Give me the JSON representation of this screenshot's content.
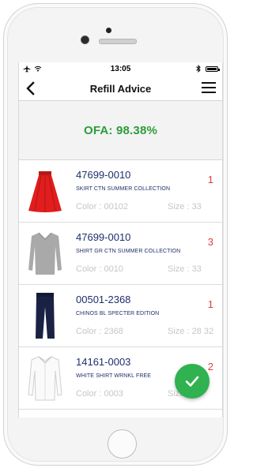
{
  "status_bar": {
    "time": "13:05",
    "icons": [
      "airplane-icon",
      "wifi-icon",
      "bluetooth-icon",
      "battery-icon"
    ]
  },
  "nav": {
    "title": "Refill Advice",
    "back_icon": "chevron-left-icon",
    "menu_icon": "hamburger-menu-icon"
  },
  "ofa": {
    "label": "OFA: 98.38%",
    "color": "#2a9d3a"
  },
  "products": [
    {
      "sku": "47699-0010",
      "description": "SKIRT CTN SUMMER COLLECTION",
      "color": "Color : 00102",
      "size": "Size : 33",
      "qty": "1",
      "thumb_icon": "red-skirt-image"
    },
    {
      "sku": "47699-0010",
      "description": "SHIRT GR CTN SUMMER COLLECTION",
      "color": "Color : 0010",
      "size": "Size : 33",
      "qty": "3",
      "thumb_icon": "grey-sweater-image"
    },
    {
      "sku": "00501-2368",
      "description": "CHINOS BL SPECTER EDITION",
      "color": "Color : 2368",
      "size": "Size : 28  32",
      "qty": "1",
      "thumb_icon": "navy-chinos-image"
    },
    {
      "sku": "14161-0003",
      "description": "WHITE SHIRT WRNKL FREE",
      "color": "Color : 0003",
      "size": "Size : 33",
      "qty": "2",
      "thumb_icon": "white-shirt-image"
    }
  ],
  "fab": {
    "icon": "checkmark-icon",
    "color": "#2fb24f"
  },
  "colors": {
    "accent_green": "#2fb24f",
    "sku_blue": "#1e2f6b",
    "qty_red": "#e23b3b",
    "muted_grey": "#c6c6c6"
  }
}
